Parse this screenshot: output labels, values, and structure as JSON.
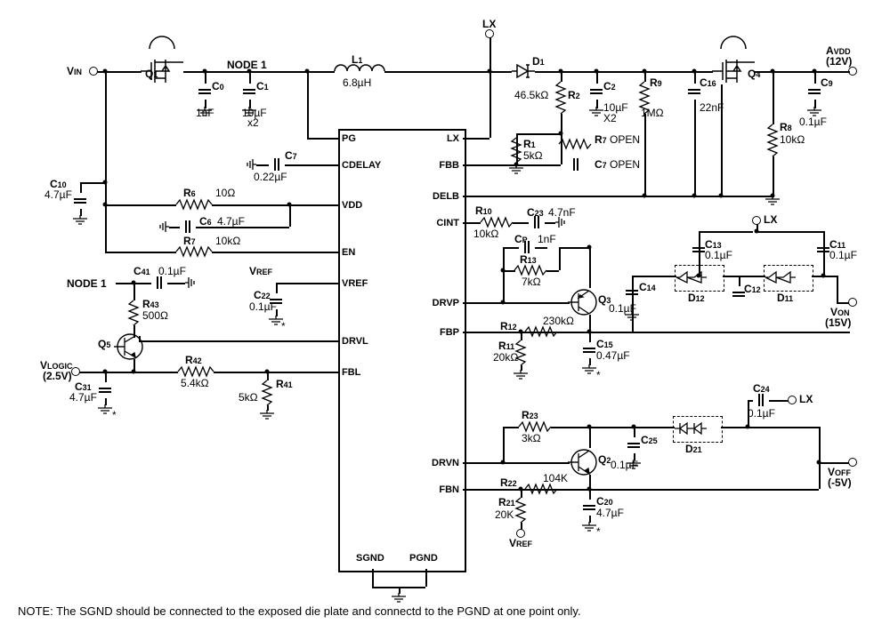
{
  "nets": {
    "vin": "V",
    "vin_sub": "IN",
    "lx": "LX",
    "avdd": "A",
    "avdd_sub": "VDD",
    "avdd_val": "(12V)",
    "von": "V",
    "von_sub": "ON",
    "von_val": "(15V)",
    "voff": "V",
    "voff_sub": "OFF",
    "voff_val": "(-5V)",
    "vlogic": "V",
    "vlogic_sub": "LOGIC",
    "vlogic_val": "(2.5V)",
    "vref": "V",
    "vref_sub": "REF",
    "node1": "NODE 1",
    "node1b": "NODE 1"
  },
  "ic_pins": {
    "pg": "PG",
    "cdelay": "CDELAY",
    "vdd": "VDD",
    "en": "EN",
    "vref": "VREF",
    "drvl": "DRVL",
    "fbl": "FBL",
    "lx": "LX",
    "fbb": "FBB",
    "delb": "DELB",
    "cint": "CINT",
    "drvp": "DRVP",
    "fbp": "FBP",
    "drvn": "DRVN",
    "fbn": "FBN",
    "sgnd": "SGND",
    "pgnd": "PGND"
  },
  "parts": {
    "q1": "Q",
    "q1_sub": "1",
    "q2": "Q",
    "q2_sub": "2",
    "q3": "Q",
    "q3_sub": "3",
    "q4": "Q",
    "q4_sub": "4",
    "q5": "Q",
    "q5_sub": "5",
    "l1": "L",
    "l1_sub": "1",
    "l1_val": "6.8µH",
    "d1": "D",
    "d1_sub": "1",
    "d11": "D",
    "d11_sub": "11",
    "d12": "D",
    "d12_sub": "12",
    "d21": "D",
    "d21_sub": "21",
    "c0": "C",
    "c0_sub": "0",
    "c0_val": "1nF",
    "c1": "C",
    "c1_sub": "1",
    "c1_val": "10µF",
    "c1_mult": "x2",
    "c2": "C",
    "c2_sub": "2",
    "c2_val": "10µF",
    "c2_mult": "X2",
    "c6": "C",
    "c6_sub": "6",
    "c6_val": "4.7µF",
    "c7": "C",
    "c7_sub": "7",
    "c7_val": "0.22µF",
    "c7b": "C",
    "c7b_sub": "7",
    "c7b_val": "OPEN",
    "c9": "C",
    "c9_sub": "9",
    "c9_val": "0.1µF",
    "c10": "C",
    "c10_sub": "10",
    "c10_val": "4.7µF",
    "c11": "C",
    "c11_sub": "11",
    "c11_val": "0.1µF",
    "c12": "C",
    "c12_sub": "12",
    "c13": "C",
    "c13_sub": "13",
    "c13_val": "0.1µF",
    "c14": "C",
    "c14_sub": "14",
    "c14_val": "0.1µF",
    "c15": "C",
    "c15_sub": "15",
    "c15_val": "0.47µF",
    "c16": "C",
    "c16_sub": "16",
    "c16_val": "22nF",
    "c20": "C",
    "c20_sub": "20",
    "c20_val": "4.7µF",
    "c22": "C",
    "c22_sub": "22",
    "c22_val": "0.1µF",
    "c23": "C",
    "c23_sub": "23",
    "c23_val": "4.7nF",
    "c24": "C",
    "c24_sub": "24",
    "c24_val": "0.1µF",
    "c25": "C",
    "c25_sub": "25",
    "c25_val": "0.1µF",
    "c31": "C",
    "c31_sub": "31",
    "c31_val": "4.7µF",
    "c41": "C",
    "c41_sub": "41",
    "c41_val": "0.1µF",
    "cp": "C",
    "cp_sub": "P",
    "cp_val": "1nF",
    "r1": "R",
    "r1_sub": "1",
    "r1_val": "5kΩ",
    "r2": "R",
    "r2_sub": "2",
    "r2_val": "46.5kΩ",
    "r6": "R",
    "r6_sub": "6",
    "r6_val": "10Ω",
    "r7": "R",
    "r7_sub": "7",
    "r7_val": "10kΩ",
    "r7b": "R",
    "r7b_sub": "7",
    "r7b_val": "OPEN",
    "r8": "R",
    "r8_sub": "8",
    "r8_val": "10kΩ",
    "r9": "R",
    "r9_sub": "9",
    "r9_val": "1MΩ",
    "r10": "R",
    "r10_sub": "10",
    "r10_val": "10kΩ",
    "r11": "R",
    "r11_sub": "11",
    "r11_val": "20kΩ",
    "r12": "R",
    "r12_sub": "12",
    "r12_val": "230kΩ",
    "r13": "R",
    "r13_sub": "13",
    "r13_val": "7kΩ",
    "r21": "R",
    "r21_sub": "21",
    "r21_val": "20K",
    "r22": "R",
    "r22_sub": "22",
    "r22_val": "104K",
    "r23": "R",
    "r23_sub": "23",
    "r23_val": "3kΩ",
    "r41": "R",
    "r41_sub": "41",
    "r41_val": "5kΩ",
    "r42": "R",
    "r42_sub": "42",
    "r42_val": "5.4kΩ",
    "r43": "R",
    "r43_sub": "43",
    "r43_val": "500Ω"
  },
  "note": "NOTE:  The SGND should be connected to the exposed die plate and connectd to the PGND at one point only.",
  "star": "*"
}
